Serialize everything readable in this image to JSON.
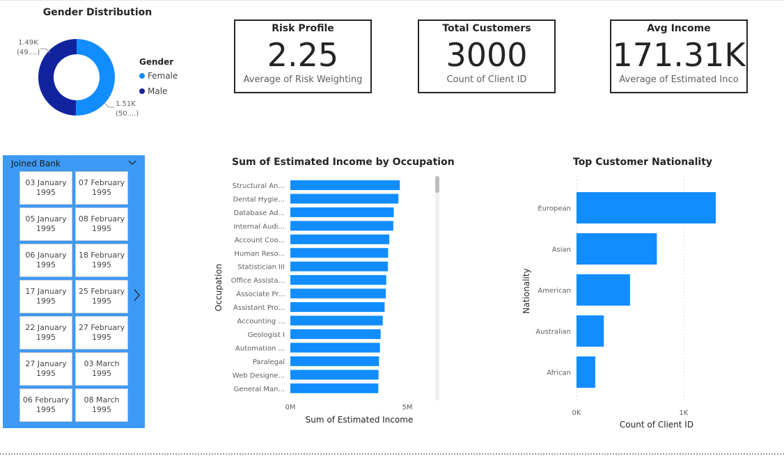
{
  "colors": {
    "accent": "#118dff",
    "male": "#12239e",
    "slicer_bg": "#3d9af7"
  },
  "gender": {
    "title": "Gender Distribution",
    "legend_title": "Gender",
    "items": [
      {
        "label": "Female",
        "value": 1510,
        "label_value": "1.51K",
        "label_pct": "(50....)",
        "color": "#118dff"
      },
      {
        "label": "Male",
        "value": 1490,
        "label_value": "1.49K",
        "label_pct": "(49....)",
        "color": "#12239e"
      }
    ]
  },
  "kpis": {
    "risk": {
      "title": "Risk Profile",
      "value": "2.25",
      "sub": "Average of Risk Weighting"
    },
    "customers": {
      "title": "Total Customers",
      "value": "3000",
      "sub": "Count of Client ID"
    },
    "income": {
      "title": "Avg Income",
      "value": "171.31K",
      "sub": "Average of Estimated Inco"
    }
  },
  "slicer": {
    "title": "Joined Bank",
    "dates": [
      [
        "03 January",
        "1995"
      ],
      [
        "07 February",
        "1995"
      ],
      [
        "05 January",
        "1995"
      ],
      [
        "08 February",
        "1995"
      ],
      [
        "06 January",
        "1995"
      ],
      [
        "18 February",
        "1995"
      ],
      [
        "17 January",
        "1995"
      ],
      [
        "25 February",
        "1995"
      ],
      [
        "22 January",
        "1995"
      ],
      [
        "27 February",
        "1995"
      ],
      [
        "27 January",
        "1995"
      ],
      [
        "03 March",
        "1995"
      ],
      [
        "06 February",
        "1995"
      ],
      [
        "08 March",
        "1995"
      ]
    ]
  },
  "chart_data": [
    {
      "type": "bar",
      "orientation": "horizontal",
      "title": "Sum of Estimated Income by Occupation",
      "xlabel": "Sum of Estimated Income",
      "ylabel": "Occupation",
      "xlim": [
        0,
        5000000
      ],
      "xticks": [
        "0M",
        "5M"
      ],
      "categories": [
        "Structural An...",
        "Dental Hygie...",
        "Database Ad...",
        "Internal Audi...",
        "Account Coo...",
        "Human Reso...",
        "Statistician III",
        "Office Assista...",
        "Associate Pr...",
        "Assistant Pro...",
        "Accounting ...",
        "Geologist I",
        "Automation ...",
        "Paralegal",
        "Web Designe...",
        "General Man..."
      ],
      "values": [
        4680000,
        4620000,
        4420000,
        4400000,
        4230000,
        4180000,
        4170000,
        4100000,
        4080000,
        4030000,
        3950000,
        3860000,
        3830000,
        3790000,
        3770000,
        3760000
      ]
    },
    {
      "type": "bar",
      "orientation": "horizontal",
      "title": "Top Customer Nationality",
      "xlabel": "Count of Client ID",
      "ylabel": "Nationality",
      "xlim": [
        0,
        1300
      ],
      "xticks": [
        "0K",
        "1K"
      ],
      "categories": [
        "European",
        "Asian",
        "American",
        "Australian",
        "African"
      ],
      "values": [
        1300,
        750,
        500,
        255,
        175
      ]
    }
  ]
}
